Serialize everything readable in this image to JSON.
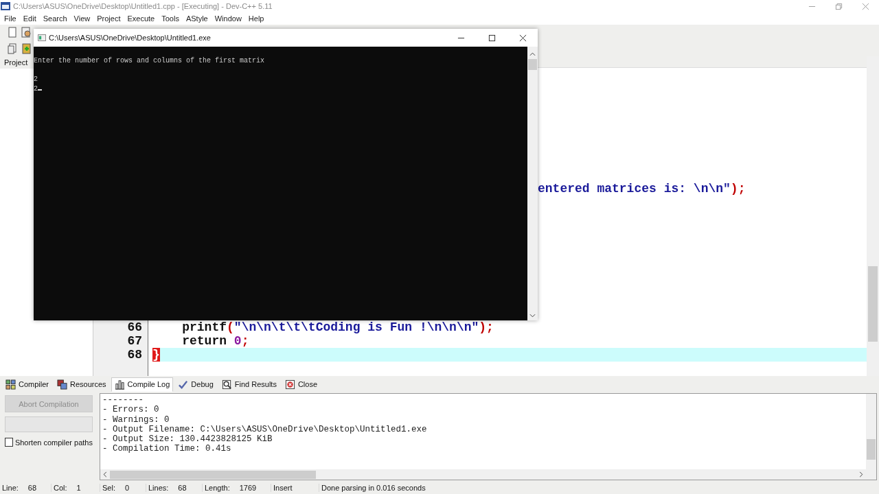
{
  "window": {
    "title": "C:\\Users\\ASUS\\OneDrive\\Desktop\\Untitled1.cpp - [Executing] - Dev-C++ 5.11",
    "active": false
  },
  "menu": [
    "File",
    "Edit",
    "Search",
    "View",
    "Project",
    "Execute",
    "Tools",
    "AStyle",
    "Window",
    "Help"
  ],
  "left_panel": {
    "tab": "Project"
  },
  "editor": {
    "partial_line": [
      {
        "kind": "string",
        "text": "entered matrices is: \\n\\n\""
      },
      {
        "kind": "punct",
        "text": ");"
      }
    ],
    "lines": [
      {
        "number": "66",
        "current": false,
        "tokens": [
          {
            "kind": "ident",
            "text": "    printf"
          },
          {
            "kind": "punct",
            "text": "("
          },
          {
            "kind": "string",
            "text": "\"\\n\\n\\t\\t\\tCoding is Fun !\\n\\n\\n\""
          },
          {
            "kind": "punct",
            "text": ");"
          }
        ]
      },
      {
        "number": "67",
        "current": false,
        "tokens": [
          {
            "kind": "keyword",
            "text": "    return "
          },
          {
            "kind": "number",
            "text": "0"
          },
          {
            "kind": "punct",
            "text": ";"
          }
        ]
      },
      {
        "number": "68",
        "current": true,
        "tokens": [
          {
            "kind": "brace-match",
            "text": "}"
          }
        ]
      }
    ]
  },
  "console": {
    "title": "C:\\Users\\ASUS\\OneDrive\\Desktop\\Untitled1.exe",
    "cursor": true,
    "output": "Enter the number of rows and columns of the first matrix\n\n2\n2"
  },
  "bottom_tabs": [
    {
      "label": "Compiler",
      "selected": false
    },
    {
      "label": "Resources",
      "selected": false
    },
    {
      "label": "Compile Log",
      "selected": true
    },
    {
      "label": "Debug",
      "selected": false
    },
    {
      "label": "Find Results",
      "selected": false
    },
    {
      "label": "Close",
      "selected": false
    }
  ],
  "compiler_panel": {
    "abort_button": {
      "label": "Abort Compilation",
      "disabled": true
    },
    "progress": {
      "level": 0
    },
    "shorten_paths": {
      "label": "Shorten compiler paths",
      "checked": false
    }
  },
  "compile_log": [
    "--------",
    "- Errors: 0",
    "- Warnings: 0",
    "- Output Filename: C:\\Users\\ASUS\\OneDrive\\Desktop\\Untitled1.exe",
    "- Output Size: 130.4423828125 KiB",
    "- Compilation Time: 0.41s"
  ],
  "status_bar": [
    {
      "label": "Line:",
      "value": "68"
    },
    {
      "label": "Col:",
      "value": "1"
    },
    {
      "label": "Sel:",
      "value": "0"
    },
    {
      "label": "Lines:",
      "value": "68"
    },
    {
      "label": "Length:",
      "value": "1769"
    },
    {
      "label": "Insert"
    },
    {
      "label": "Done parsing in 0.016 seconds"
    }
  ]
}
